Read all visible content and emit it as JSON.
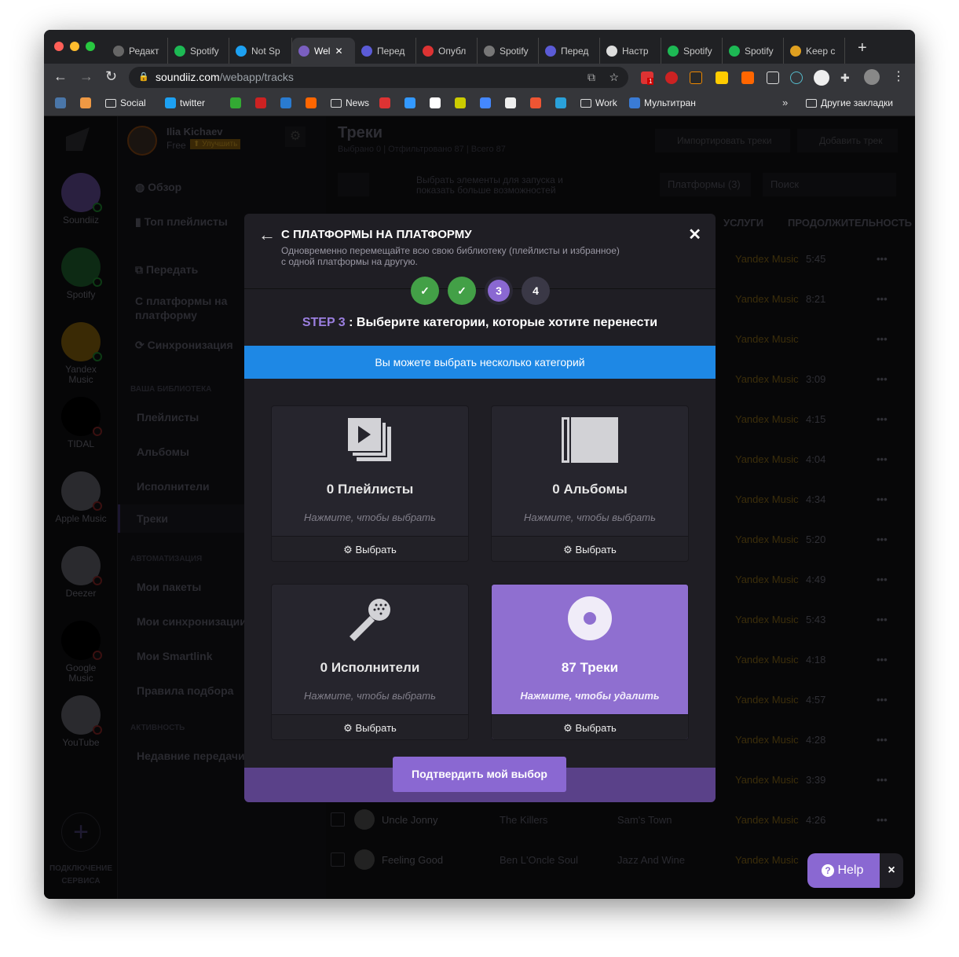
{
  "browser": {
    "tabs": [
      {
        "label": "Редакт",
        "icon": "globe-icon",
        "color": "#666"
      },
      {
        "label": "Spotify",
        "icon": "spotify-icon",
        "color": "#1db954"
      },
      {
        "label": "Not Sp",
        "icon": "twitter-icon",
        "color": "#1da1f2"
      },
      {
        "label": "Wel",
        "icon": "soundiiz-icon",
        "color": "#7a5fc0",
        "active": true
      },
      {
        "label": "Перед",
        "icon": "my-icon",
        "color": "#5b5bd6"
      },
      {
        "label": "Опубл",
        "icon": "gmail-icon",
        "color": "#d33"
      },
      {
        "label": "Spotify",
        "icon": "spotify-icon",
        "color": "#777"
      },
      {
        "label": "Перед",
        "icon": "my-icon",
        "color": "#5b5bd6"
      },
      {
        "label": "Настр",
        "icon": "gear-icon",
        "color": "#ddd"
      },
      {
        "label": "Spotify",
        "icon": "spotify-icon",
        "color": "#1db954"
      },
      {
        "label": "Spotify",
        "icon": "spotify-icon",
        "color": "#1db954"
      },
      {
        "label": "Keep c",
        "icon": "deezer-icon",
        "color": "#e0a020"
      }
    ],
    "url_host": "soundiiz.com",
    "url_path": "/webapp/tracks",
    "bookmarks": [
      {
        "label": "",
        "icon": "vk-icon",
        "color": "#4a76a8"
      },
      {
        "label": "",
        "icon": "gmail-icon",
        "color": "#e94"
      },
      {
        "label": "Social",
        "icon": "folder-icon"
      },
      {
        "label": "twitter",
        "icon": "twitter-icon",
        "color": "#1da1f2"
      },
      {
        "label": "",
        "icon": "app-icon",
        "color": "#3a3"
      },
      {
        "label": "",
        "icon": "opera-icon",
        "color": "#c22"
      },
      {
        "label": "",
        "icon": "b-icon",
        "color": "#2a7bd0"
      },
      {
        "label": "",
        "icon": "film-icon",
        "color": "#f60"
      },
      {
        "label": "News",
        "icon": "folder-icon"
      },
      {
        "label": "",
        "icon": "gmail-icon",
        "color": "#d33"
      },
      {
        "label": "",
        "icon": "drop-icon",
        "color": "#39f"
      },
      {
        "label": "",
        "icon": "google-icon",
        "color": "#fff"
      },
      {
        "label": "",
        "icon": "g-icon",
        "color": "#cc0"
      },
      {
        "label": "",
        "icon": "translate-icon",
        "color": "#48f"
      },
      {
        "label": "",
        "icon": "globe-icon",
        "color": "#eee"
      },
      {
        "label": "",
        "icon": "ext-icon",
        "color": "#e53"
      },
      {
        "label": "",
        "icon": "telegram-icon",
        "color": "#2aa1da"
      },
      {
        "label": "Work",
        "icon": "folder-icon"
      },
      {
        "label": "Мультитран",
        "icon": "multitran-icon",
        "color": "#3a7bd5"
      }
    ],
    "other_bookmarks": "Другие закладки",
    "badge_count": "1"
  },
  "app": {
    "user": {
      "name": "Ilia Kichaev",
      "plan": "Free",
      "upgrade": "⬆ Улучшить"
    },
    "services": [
      {
        "label": "Soundiiz",
        "color": "#2a2040"
      },
      {
        "label": "Spotify",
        "color": "#0d2a14"
      },
      {
        "label": "Yandex Music",
        "color": "#3a2a05"
      },
      {
        "label": "TIDAL",
        "color": "#000"
      },
      {
        "label": "Apple Music",
        "color": "#2a2a2e"
      },
      {
        "label": "Deezer",
        "color": "#2a2a2e"
      },
      {
        "label": "Google Music",
        "color": "#000"
      },
      {
        "label": "YouTube",
        "color": "#2a2a2e"
      }
    ],
    "connect": "ПОДКЛЮЧЕНИЕ СЕРВИСА",
    "nav": {
      "overview": "Обзор",
      "top": "Топ плейлисты",
      "transfer": "Передать",
      "p2p": "С платформы на платформу",
      "sync": "Синхронизация",
      "lib_header": "ВАША БИБЛИОТЕКА",
      "playlists": "Плейлисты",
      "albums": "Альбомы",
      "artists": "Исполнители",
      "tracks": "Треки",
      "auto_header": "АВТОМАТИЗАЦИЯ",
      "packs": "Мои пакеты",
      "syncs": "Мои синхронизации",
      "smartlink": "Мои Smartlink",
      "rules": "Правила подбора",
      "act_header": "АКТИВНОСТЬ",
      "recent": "Недавние передачи"
    },
    "page_title": "Треки",
    "stats": "Выбрано 0 | Отфильтровано 87 | Всего 87",
    "import": "Импортировать треки",
    "add": "Добавить трек",
    "hint": "Выбрать элементы для запуска и показать больше возможностей",
    "platforms": "Платформы (3)",
    "search_placeholder": "Поиск",
    "columns": {
      "services": "УСЛУГИ",
      "duration": "ПРОДОЛЖИТЕЛЬНОСТЬ"
    },
    "rows": [
      {
        "service": "Yandex Music",
        "duration": "5:45"
      },
      {
        "service": "Yandex Music",
        "duration": "8:21"
      },
      {
        "service": "Yandex Music",
        "duration": ""
      },
      {
        "service": "Yandex Music",
        "duration": "3:09"
      },
      {
        "service": "Yandex Music",
        "duration": "4:15"
      },
      {
        "service": "Yandex Music",
        "duration": "4:04"
      },
      {
        "service": "Yandex Music",
        "duration": "4:34"
      },
      {
        "service": "Yandex Music",
        "duration": "5:20"
      },
      {
        "service": "Yandex Music",
        "duration": "4:49"
      },
      {
        "service": "Yandex Music",
        "duration": "5:43"
      },
      {
        "service": "Yandex Music",
        "duration": "4:18"
      },
      {
        "service": "Yandex Music",
        "duration": "4:57"
      },
      {
        "service": "Yandex Music",
        "duration": "4:28"
      },
      {
        "service": "Yandex Music",
        "duration": "3:39"
      },
      {
        "name": "Uncle Jonny",
        "artist": "The Killers",
        "album": "Sam's Town",
        "service": "Yandex Music",
        "duration": "4:26"
      },
      {
        "name": "Feeling Good",
        "artist": "Ben L'Oncle Soul",
        "album": "Jazz And Wine",
        "service": "Yandex Music",
        "duration": ""
      }
    ]
  },
  "modal": {
    "title": "С ПЛАТФОРМЫ НА ПЛАТФОРМУ",
    "subtitle1": "Одновременно перемещайте всю свою библиотеку (плейлисты и избранное)",
    "subtitle2": "с одной платформы на другую.",
    "steps": [
      {
        "label": "✓",
        "state": "done"
      },
      {
        "label": "✓",
        "state": "done"
      },
      {
        "label": "3",
        "state": "current"
      },
      {
        "label": "4",
        "state": "pending"
      }
    ],
    "step_prefix": "STEP 3",
    "step_text": " : Выберите категории, которые хотите перенести",
    "info": "Вы можете выбрать несколько категорий",
    "cards": [
      {
        "title": "0 Плейлисты",
        "hint": "Нажмите, чтобы выбрать",
        "action": "Выбрать",
        "selected": false
      },
      {
        "title": "0 Альбомы",
        "hint": "Нажмите, чтобы выбрать",
        "action": "Выбрать",
        "selected": false
      },
      {
        "title": "0 Исполнители",
        "hint": "Нажмите, чтобы выбрать",
        "action": "Выбрать",
        "selected": false
      },
      {
        "title": "87 Треки",
        "hint": "Нажмите, чтобы удалить",
        "action": "Выбрать",
        "selected": true
      }
    ],
    "confirm": "Подтвердить мой выбор"
  },
  "help": {
    "label": "Help",
    "close": "×"
  },
  "colors": {
    "accent": "#8a68d2",
    "info": "#1e88e5",
    "done": "#43a047"
  }
}
